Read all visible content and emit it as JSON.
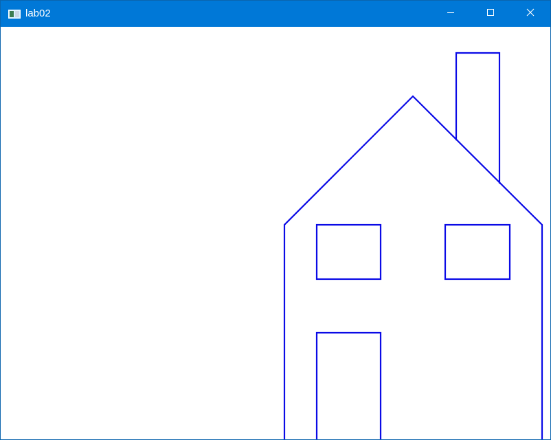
{
  "window": {
    "title": "lab02",
    "icon": "window-app-icon",
    "controls": {
      "minimize_icon": "minimize-icon",
      "maximize_icon": "maximize-icon",
      "close_icon": "close-icon"
    }
  },
  "canvas": {
    "background_color": "#ffffff",
    "stroke_color": "#0000ee",
    "drawing": "house-outline"
  },
  "colors": {
    "titlebar": "#0078d7",
    "title_text": "#ffffff"
  }
}
